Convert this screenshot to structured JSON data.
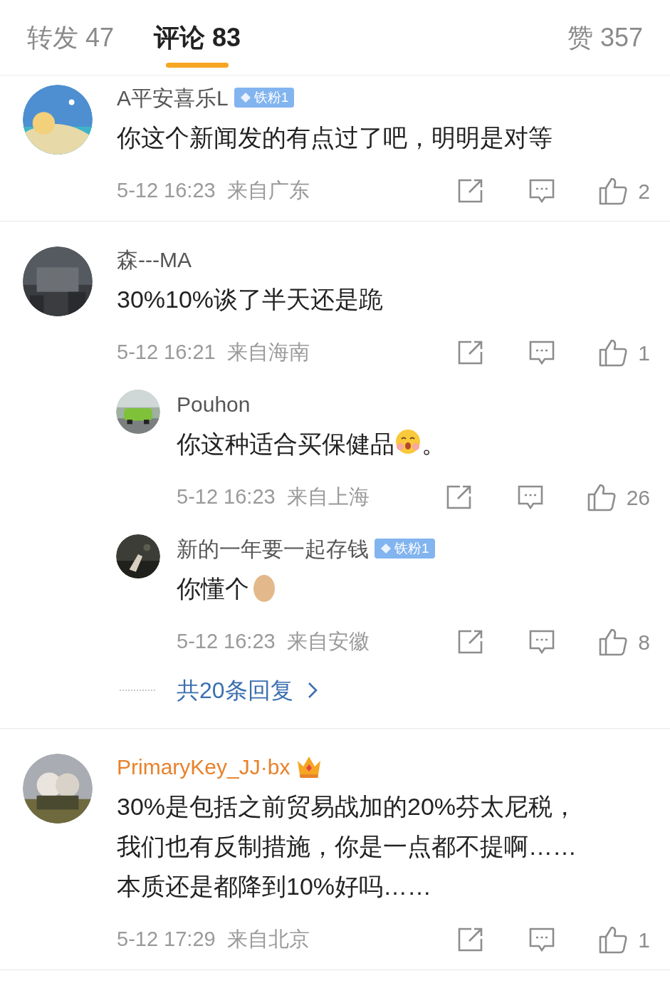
{
  "tabs": [
    {
      "label": "转发 47",
      "selected": false
    },
    {
      "label": "评论 83",
      "selected": true
    },
    {
      "label": "赞 357",
      "selected": false
    }
  ],
  "comments": [
    {
      "name": "A平安喜乐L",
      "vip": false,
      "badge": "铁粉1",
      "text_lines": [
        [
          {
            "kind": "text",
            "text": "你这个新闻发的有点过了吧，明明是对等"
          }
        ]
      ],
      "time": "5-12 16:23",
      "location": "来自广东",
      "likes": "2"
    },
    {
      "name": "森---MA",
      "vip": false,
      "text_lines": [
        [
          {
            "kind": "text",
            "text": "30%10%谈了半天还是跪"
          }
        ]
      ],
      "time": "5-12 16:21",
      "location": "来自海南",
      "likes": "1",
      "replies": [
        {
          "name": "Pouhon",
          "vip": false,
          "text_lines": [
            [
              {
                "kind": "text",
                "text": "你这种适合买保健品"
              },
              {
                "kind": "blush-emoji"
              },
              {
                "kind": "text",
                "text": "。"
              }
            ]
          ],
          "time": "5-12 16:23",
          "location": "来自上海",
          "likes": "26"
        },
        {
          "name": "新的一年要一起存钱",
          "vip": false,
          "badge": "铁粉1",
          "text_lines": [
            [
              {
                "kind": "text",
                "text": "你懂个"
              },
              {
                "kind": "egg-emoji"
              }
            ]
          ],
          "time": "5-12 16:23",
          "location": "来自安徽",
          "likes": "8"
        }
      ],
      "more_replies": "共20条回复"
    },
    {
      "name": "PrimaryKey_JJ·bx",
      "vip": true,
      "text_lines": [
        [
          {
            "kind": "text",
            "text": "30%是包括之前贸易战加的20%芬太尼税，"
          }
        ],
        [
          {
            "kind": "text",
            "text": "我们也有反制措施，你是一点都不提啊……"
          }
        ],
        [
          {
            "kind": "text",
            "text": "本质还是都降到10%好吗……"
          }
        ]
      ],
      "time": "5-12 17:29",
      "location": "来自北京",
      "likes": "1"
    }
  ]
}
